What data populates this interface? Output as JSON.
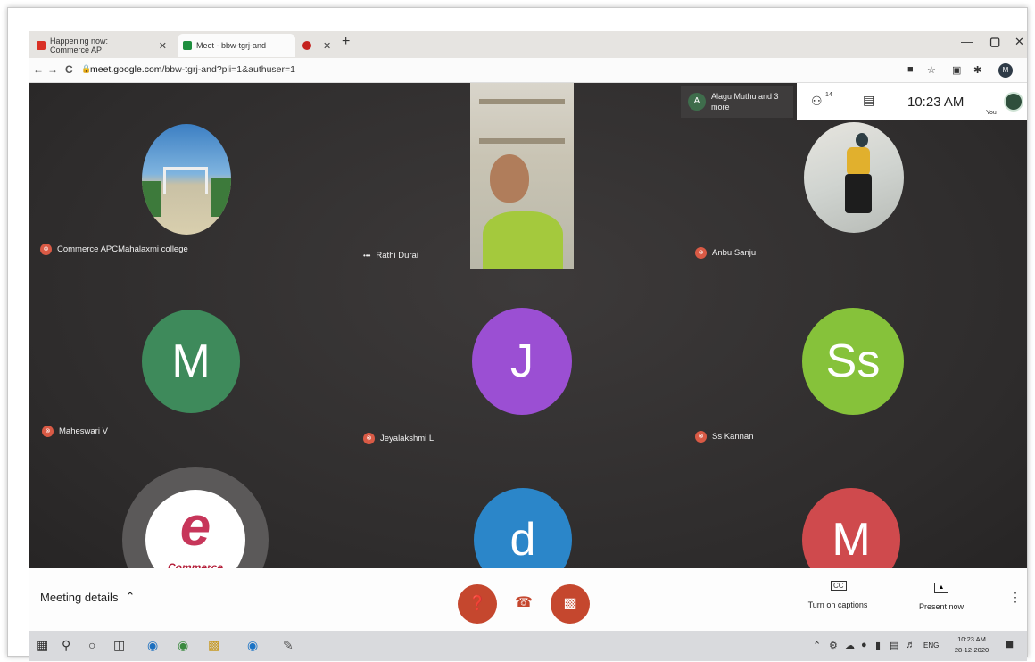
{
  "browser": {
    "tabs": [
      {
        "label": "Happening now: Commerce AP",
        "close": "✕"
      },
      {
        "label": "Meet - bbw-tgrj-and",
        "close": "✕"
      },
      {
        "label": "",
        "close": "✕"
      }
    ],
    "new_tab": "+",
    "url_prefix": "meet.google.com",
    "url_rest": "/bbw-tgrj-and?pli=1&authuser=1",
    "reload": "C",
    "profile_initial": "M"
  },
  "meet": {
    "participants_count": "14",
    "time": "10:23 AM",
    "you_label": "You",
    "chip": {
      "initial": "A",
      "text": "Alagu Muthu and 3 more"
    },
    "tiles": [
      {
        "name": "Commerce APCMahalaxmi college"
      },
      {
        "name": "Rathi Durai"
      },
      {
        "name": "Anbu Sanju"
      },
      {
        "name": "Maheswari V",
        "initial": "M"
      },
      {
        "name": "Jeyalakshmi L",
        "initial": "J"
      },
      {
        "name": "Ss Kannan",
        "initial": "Ss"
      },
      {
        "name": "",
        "logo_text": "Commerce",
        "logo_mark": "e"
      },
      {
        "name": "",
        "initial": "d"
      },
      {
        "name": "",
        "initial": "M"
      }
    ],
    "more_glyph": "•••",
    "mic_off_glyph": "̸"
  },
  "bottom": {
    "meeting_details": "Meeting details",
    "captions": "Turn on captions",
    "captions_icon": "CC",
    "present": "Present now",
    "more": "⋮"
  },
  "taskbar": {
    "lang": "ENG",
    "time": "10:23 AM",
    "date": "28-12-2020"
  },
  "colors": {
    "avatar_green": "#3e8a5b",
    "avatar_purple": "#9b4fd3",
    "avatar_lime": "#86c23a",
    "avatar_blue": "#2b86c9",
    "avatar_red": "#cf4a4d",
    "hangup_red": "#c5472e"
  }
}
